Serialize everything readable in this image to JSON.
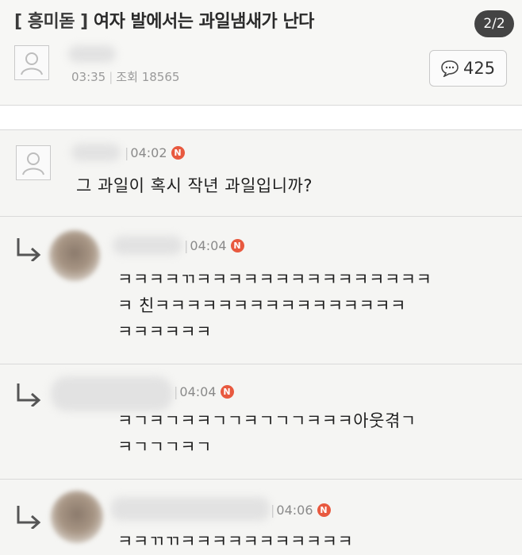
{
  "post": {
    "category": "[ 흥미돋 ]",
    "title": "여자 발에서는 과일냄새가 난다",
    "page_indicator": "2/2",
    "time": "03:35",
    "views_label": "조회",
    "views": "18565",
    "comment_count": "425"
  },
  "comments": [
    {
      "time": "04:02",
      "badge": "N",
      "text_lines": [
        "그 과일이 혹시 작년 과일입니까?"
      ]
    }
  ],
  "replies": [
    {
      "time": "04:04",
      "badge": "N",
      "text_lines": [
        "ㅋㅋㅋㅋㄲㅋㅋㅋㅋㅋㅋㅋㅋㅋㅋㅋㅋㅋㅋㅋ",
        "ㅋ  친ㅋㅋㅋㅋㅋㅋㅋㅋㅋㅋㅋㅋㅋㅋㅋㅋ",
        "ㅋㅋㅋㅋㅋㅋ"
      ]
    },
    {
      "time": "04:04",
      "badge": "N",
      "text_lines": [
        "ㅋㄱㅋㄱㅋㅋㄱㄱㅋㄱㄱㄱㅋㅋㅋ아웃겪ㄱ",
        "ㅋㄱㄱㄱㅋㄱ"
      ]
    },
    {
      "time": "04:06",
      "badge": "N",
      "text_lines": [
        "ㅋㅋㄲㄲㅋㅋㅋㅋㅋㅋㅋㅋㅋㅋㅋ"
      ]
    }
  ],
  "colors": {
    "badge_red": "#e8593f",
    "page_badge_bg": "#444444",
    "background": "#f5f5f3"
  },
  "icons": [
    "default-avatar-icon",
    "comment-bubble-icon",
    "reply-arrow-icon",
    "new-badge-icon"
  ]
}
